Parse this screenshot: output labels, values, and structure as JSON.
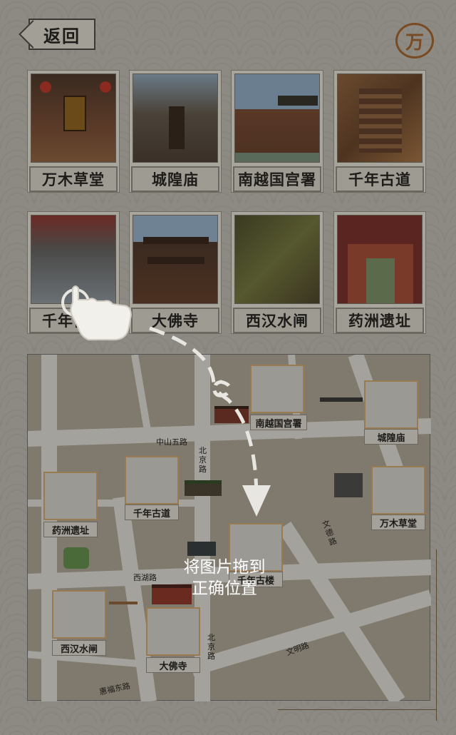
{
  "back_label": "返回",
  "logo_glyph": "万",
  "cards": [
    {
      "label": "万木草堂"
    },
    {
      "label": "城隍庙"
    },
    {
      "label": "南越国宫署"
    },
    {
      "label": "千年古道"
    },
    {
      "label": "千年古楼"
    },
    {
      "label": "大佛寺"
    },
    {
      "label": "西汉水闸"
    },
    {
      "label": "药洲遗址"
    }
  ],
  "map": {
    "roads": [
      "中山五路",
      "北京路",
      "西湖路",
      "北京路",
      "文德路",
      "文明路",
      "惠福东路"
    ],
    "slots": [
      {
        "label": "南越国宫署"
      },
      {
        "label": "城隍庙"
      },
      {
        "label": "千年古道"
      },
      {
        "label": "药洲遗址"
      },
      {
        "label": "万木草堂"
      },
      {
        "label": "千年古楼"
      },
      {
        "label": "西汉水闸"
      },
      {
        "label": "大佛寺"
      }
    ]
  },
  "hint": {
    "line1": "将图片拖到",
    "line2": "正确位置"
  },
  "colors": {
    "accent": "#9a7a50",
    "overlay": "#8c8a83"
  }
}
